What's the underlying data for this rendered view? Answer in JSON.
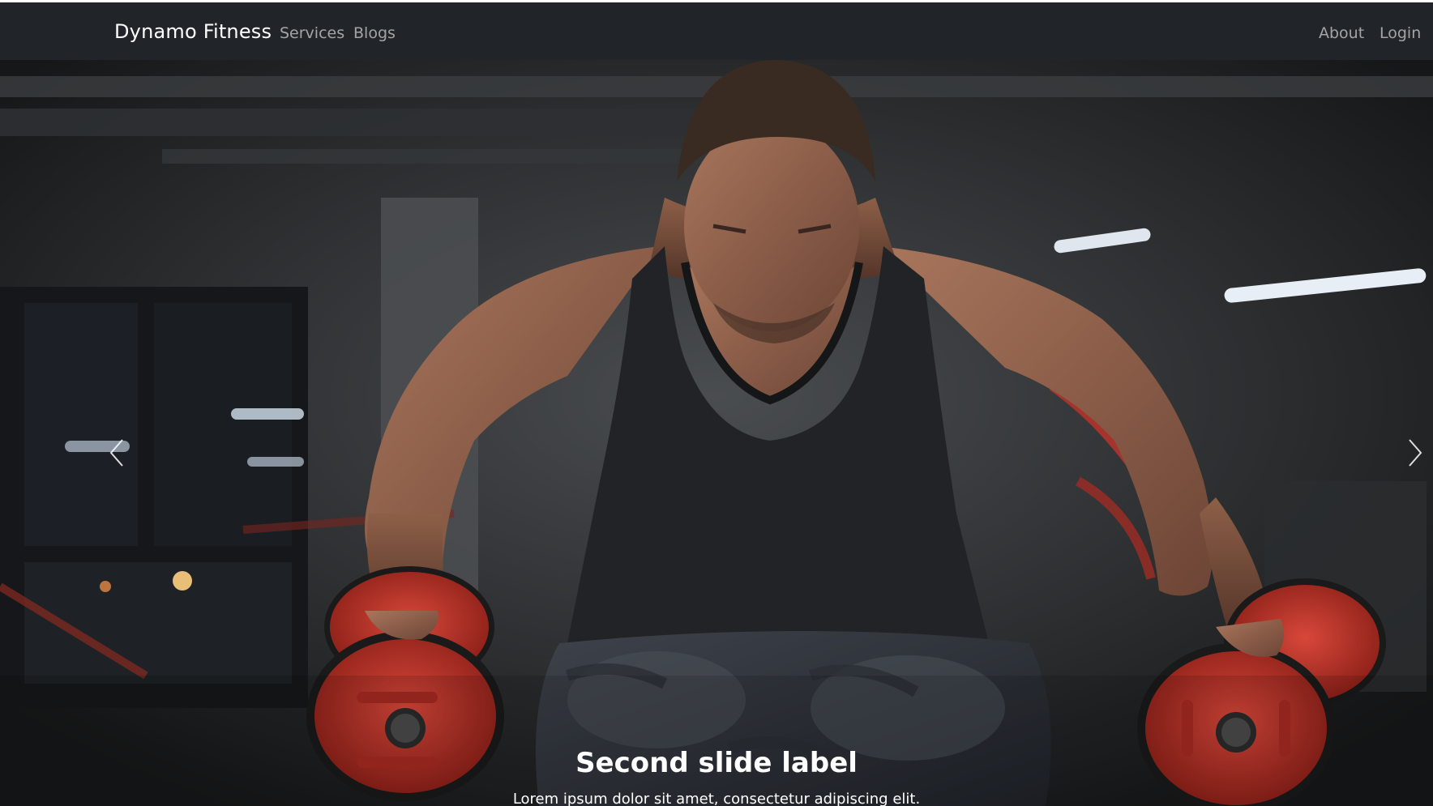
{
  "navbar": {
    "brand": "Dynamo Fitness",
    "left_links": [
      {
        "label": "Services"
      },
      {
        "label": "Blogs"
      }
    ],
    "right_links": [
      {
        "label": "About"
      },
      {
        "label": "Login"
      }
    ],
    "background_color": "#212529"
  },
  "carousel": {
    "active_slide": {
      "caption_title": "Second slide label",
      "caption_text": "Lorem ipsum dolor sit amet, consectetur adipiscing elit."
    },
    "controls": {
      "prev_icon": "chevron-left-icon",
      "next_icon": "chevron-right-icon"
    },
    "accent_colors": {
      "plate_red": "#c8362b",
      "tank_black": "#222326"
    }
  }
}
